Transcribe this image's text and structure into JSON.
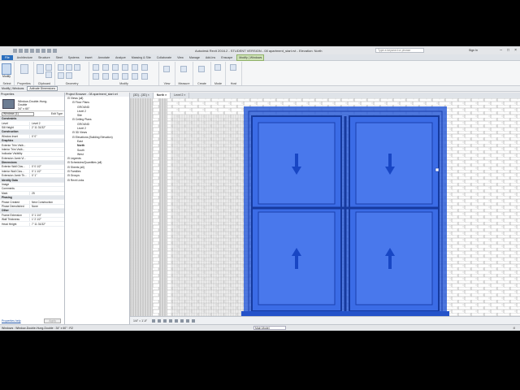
{
  "app": {
    "title": "Autodesk Revit 2016.2 - STUDENT VERSION - 08 apartment_start.rvt - Elevation: North",
    "search_placeholder": "Type a keyword or phrase",
    "sign_in": "Sign In"
  },
  "ribbon_tabs": [
    "File",
    "Architecture",
    "Structure",
    "Steel",
    "Systems",
    "Insert",
    "Annotate",
    "Analyze",
    "Massing & Site",
    "Collaborate",
    "View",
    "Manage",
    "Add-Ins",
    "Enscape",
    "Modify | Windows"
  ],
  "ribbon_panels": {
    "select": "Select",
    "properties": "Properties",
    "clipboard": "Clipboard",
    "geometry": "Geometry",
    "modify": "Modify",
    "view": "View",
    "measure": "Measure",
    "create": "Create",
    "mode": "Mode",
    "host": "Host",
    "modify_button": "Modify",
    "edit_family": "Edit Family",
    "pick_new_host": "Pick New Host"
  },
  "options_bar": {
    "label": "Modify | Windows",
    "activate_dimensions": "Activate Dimensions"
  },
  "properties": {
    "header": "Properties",
    "type_name": [
      "Window-Double-Hung-",
      "Double",
      "34\" x 60\""
    ],
    "instance_selector": "Windows (1)",
    "edit_type": "Edit Type",
    "rows": [
      {
        "group": "Constraints"
      },
      {
        "k": "Level",
        "v": "Level 2"
      },
      {
        "k": "Sill Height",
        "v": "2' 11 31/32\""
      },
      {
        "group": "Construction"
      },
      {
        "k": "Window Inset",
        "v": "0' 0\""
      },
      {
        "group": "Graphics"
      },
      {
        "k": "Exterior Trim Visib...",
        "v": ""
      },
      {
        "k": "Interior Trim Visib...",
        "v": ""
      },
      {
        "k": "Indicator Visibility",
        "v": ""
      },
      {
        "k": "Extension Jamb Vi...",
        "v": ""
      },
      {
        "group": "Dimensions"
      },
      {
        "k": "Exterior Wall Clos...",
        "v": "0' 0 1/2\""
      },
      {
        "k": "Interior Wall Clos...",
        "v": "0' 1 1/2\""
      },
      {
        "k": "Extension Jamb Th...",
        "v": "0' 1\""
      },
      {
        "group": "Identity Data"
      },
      {
        "k": "Image",
        "v": ""
      },
      {
        "k": "Comments",
        "v": ""
      },
      {
        "k": "Mark",
        "v": "25"
      },
      {
        "group": "Phasing"
      },
      {
        "k": "Phase Created",
        "v": "New Construction"
      },
      {
        "k": "Phase Demolished",
        "v": "None"
      },
      {
        "group": "Other"
      },
      {
        "k": "Frame Extension",
        "v": "0' 1 1/4\""
      },
      {
        "k": "Wall Thickness",
        "v": "1' 2 1/2\""
      },
      {
        "k": "Head Height",
        "v": "7' 11 31/32\""
      }
    ],
    "help_link": "Properties help",
    "apply": "Apply"
  },
  "project_browser": {
    "header": "Project Browser - 08 apartment_start.rvt",
    "items": [
      {
        "label": "Views (all)",
        "indent": 0
      },
      {
        "label": "Floor Plans",
        "indent": 1
      },
      {
        "label": "GROUND",
        "indent": 2
      },
      {
        "label": "Level 2",
        "indent": 2
      },
      {
        "label": "Site",
        "indent": 2
      },
      {
        "label": "Ceiling Plans",
        "indent": 1
      },
      {
        "label": "GROUND",
        "indent": 2
      },
      {
        "label": "Level 2",
        "indent": 2
      },
      {
        "label": "3D Views",
        "indent": 1
      },
      {
        "label": "Elevations (Building Elevation)",
        "indent": 1
      },
      {
        "label": "East",
        "indent": 2
      },
      {
        "label": "North",
        "indent": 2,
        "selected": true
      },
      {
        "label": "South",
        "indent": 2
      },
      {
        "label": "West",
        "indent": 2
      },
      {
        "label": "Legends",
        "indent": 0
      },
      {
        "label": "Schedules/Quantities (all)",
        "indent": 0
      },
      {
        "label": "Sheets (all)",
        "indent": 0
      },
      {
        "label": "Families",
        "indent": 0
      },
      {
        "label": "Groups",
        "indent": 0
      },
      {
        "label": "Revit Links",
        "indent": 0
      }
    ]
  },
  "view_tabs": [
    "{3D} - {3D}",
    "North",
    "Level 2"
  ],
  "view_control": {
    "scale": "1/4\" = 1'-0\""
  },
  "status_bar": {
    "message": "Windows : Window-Double-Hung-Double : 34\" x 60\" : R2",
    "workset": "Main Model",
    "filter": ":0"
  },
  "colors": {
    "selection_blue": "#2f5fd8",
    "selection_fill": "#3b6ce6",
    "context_tab": "#cfe3b8"
  }
}
